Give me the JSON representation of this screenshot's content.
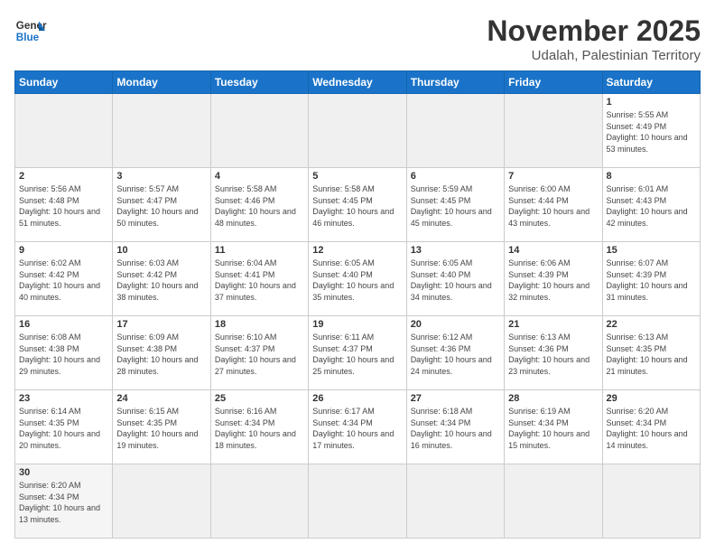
{
  "logo": {
    "line1": "General",
    "line2": "Blue"
  },
  "title": "November 2025",
  "subtitle": "Udalah, Palestinian Territory",
  "weekdays": [
    "Sunday",
    "Monday",
    "Tuesday",
    "Wednesday",
    "Thursday",
    "Friday",
    "Saturday"
  ],
  "weeks": [
    [
      {
        "day": "",
        "info": ""
      },
      {
        "day": "",
        "info": ""
      },
      {
        "day": "",
        "info": ""
      },
      {
        "day": "",
        "info": ""
      },
      {
        "day": "",
        "info": ""
      },
      {
        "day": "",
        "info": ""
      },
      {
        "day": "1",
        "info": "Sunrise: 5:55 AM\nSunset: 4:49 PM\nDaylight: 10 hours and 53 minutes."
      }
    ],
    [
      {
        "day": "2",
        "info": "Sunrise: 5:56 AM\nSunset: 4:48 PM\nDaylight: 10 hours and 51 minutes."
      },
      {
        "day": "3",
        "info": "Sunrise: 5:57 AM\nSunset: 4:47 PM\nDaylight: 10 hours and 50 minutes."
      },
      {
        "day": "4",
        "info": "Sunrise: 5:58 AM\nSunset: 4:46 PM\nDaylight: 10 hours and 48 minutes."
      },
      {
        "day": "5",
        "info": "Sunrise: 5:58 AM\nSunset: 4:45 PM\nDaylight: 10 hours and 46 minutes."
      },
      {
        "day": "6",
        "info": "Sunrise: 5:59 AM\nSunset: 4:45 PM\nDaylight: 10 hours and 45 minutes."
      },
      {
        "day": "7",
        "info": "Sunrise: 6:00 AM\nSunset: 4:44 PM\nDaylight: 10 hours and 43 minutes."
      },
      {
        "day": "8",
        "info": "Sunrise: 6:01 AM\nSunset: 4:43 PM\nDaylight: 10 hours and 42 minutes."
      }
    ],
    [
      {
        "day": "9",
        "info": "Sunrise: 6:02 AM\nSunset: 4:42 PM\nDaylight: 10 hours and 40 minutes."
      },
      {
        "day": "10",
        "info": "Sunrise: 6:03 AM\nSunset: 4:42 PM\nDaylight: 10 hours and 38 minutes."
      },
      {
        "day": "11",
        "info": "Sunrise: 6:04 AM\nSunset: 4:41 PM\nDaylight: 10 hours and 37 minutes."
      },
      {
        "day": "12",
        "info": "Sunrise: 6:05 AM\nSunset: 4:40 PM\nDaylight: 10 hours and 35 minutes."
      },
      {
        "day": "13",
        "info": "Sunrise: 6:05 AM\nSunset: 4:40 PM\nDaylight: 10 hours and 34 minutes."
      },
      {
        "day": "14",
        "info": "Sunrise: 6:06 AM\nSunset: 4:39 PM\nDaylight: 10 hours and 32 minutes."
      },
      {
        "day": "15",
        "info": "Sunrise: 6:07 AM\nSunset: 4:39 PM\nDaylight: 10 hours and 31 minutes."
      }
    ],
    [
      {
        "day": "16",
        "info": "Sunrise: 6:08 AM\nSunset: 4:38 PM\nDaylight: 10 hours and 29 minutes."
      },
      {
        "day": "17",
        "info": "Sunrise: 6:09 AM\nSunset: 4:38 PM\nDaylight: 10 hours and 28 minutes."
      },
      {
        "day": "18",
        "info": "Sunrise: 6:10 AM\nSunset: 4:37 PM\nDaylight: 10 hours and 27 minutes."
      },
      {
        "day": "19",
        "info": "Sunrise: 6:11 AM\nSunset: 4:37 PM\nDaylight: 10 hours and 25 minutes."
      },
      {
        "day": "20",
        "info": "Sunrise: 6:12 AM\nSunset: 4:36 PM\nDaylight: 10 hours and 24 minutes."
      },
      {
        "day": "21",
        "info": "Sunrise: 6:13 AM\nSunset: 4:36 PM\nDaylight: 10 hours and 23 minutes."
      },
      {
        "day": "22",
        "info": "Sunrise: 6:13 AM\nSunset: 4:35 PM\nDaylight: 10 hours and 21 minutes."
      }
    ],
    [
      {
        "day": "23",
        "info": "Sunrise: 6:14 AM\nSunset: 4:35 PM\nDaylight: 10 hours and 20 minutes."
      },
      {
        "day": "24",
        "info": "Sunrise: 6:15 AM\nSunset: 4:35 PM\nDaylight: 10 hours and 19 minutes."
      },
      {
        "day": "25",
        "info": "Sunrise: 6:16 AM\nSunset: 4:34 PM\nDaylight: 10 hours and 18 minutes."
      },
      {
        "day": "26",
        "info": "Sunrise: 6:17 AM\nSunset: 4:34 PM\nDaylight: 10 hours and 17 minutes."
      },
      {
        "day": "27",
        "info": "Sunrise: 6:18 AM\nSunset: 4:34 PM\nDaylight: 10 hours and 16 minutes."
      },
      {
        "day": "28",
        "info": "Sunrise: 6:19 AM\nSunset: 4:34 PM\nDaylight: 10 hours and 15 minutes."
      },
      {
        "day": "29",
        "info": "Sunrise: 6:20 AM\nSunset: 4:34 PM\nDaylight: 10 hours and 14 minutes."
      }
    ],
    [
      {
        "day": "30",
        "info": "Sunrise: 6:20 AM\nSunset: 4:34 PM\nDaylight: 10 hours and 13 minutes."
      },
      {
        "day": "",
        "info": ""
      },
      {
        "day": "",
        "info": ""
      },
      {
        "day": "",
        "info": ""
      },
      {
        "day": "",
        "info": ""
      },
      {
        "day": "",
        "info": ""
      },
      {
        "day": "",
        "info": ""
      }
    ]
  ]
}
